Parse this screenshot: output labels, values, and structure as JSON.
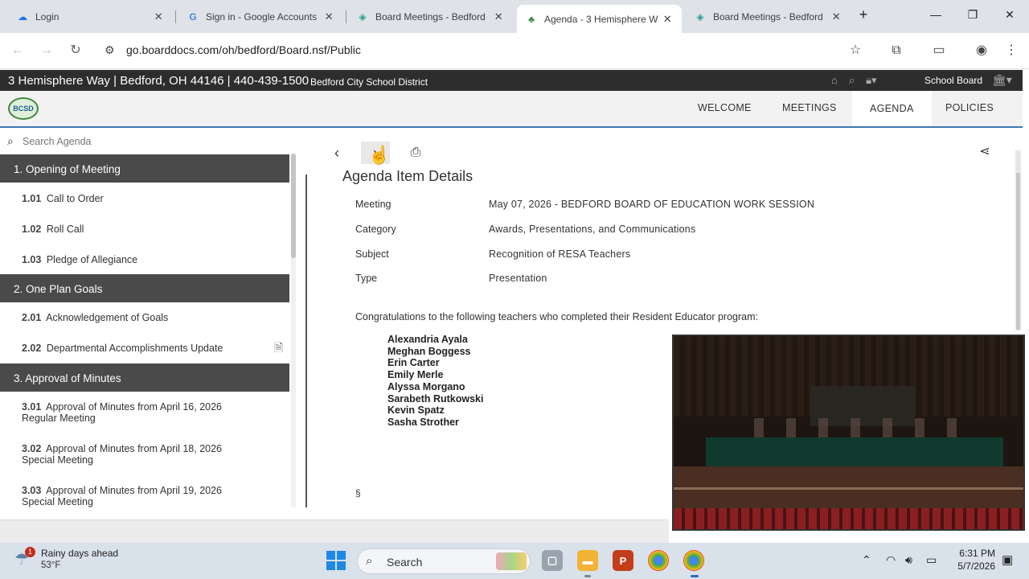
{
  "browser": {
    "tabs": [
      {
        "title": "Login",
        "favicon": "cloud-icon",
        "active": false
      },
      {
        "title": "Sign in - Google Accounts",
        "favicon": "google-icon",
        "active": false
      },
      {
        "title": "Board Meetings - Bedford",
        "favicon": "boarddocs-icon",
        "active": false
      },
      {
        "title": "Agenda - 3 Hemisphere W",
        "favicon": "tree-icon",
        "active": true
      },
      {
        "title": "Board Meetings - Bedford",
        "favicon": "boarddocs-icon",
        "active": false
      }
    ],
    "close_glyph": "✕",
    "new_tab_glyph": "+",
    "url": "go.boarddocs.com/oh/bedford/Board.nsf/Public"
  },
  "site": {
    "address": "3 Hemisphere Way | Bedford, OH 44146 | 440-439-1500",
    "district": "Bedford City School District",
    "board_label": "School Board",
    "logo_text": "BCSD",
    "nav": [
      "WELCOME",
      "MEETINGS",
      "AGENDA",
      "POLICIES"
    ],
    "active_nav": "AGENDA"
  },
  "sidebar": {
    "search_placeholder": "Search Agenda",
    "sections": [
      {
        "header": "1. Opening of Meeting",
        "items": [
          {
            "num": "1.01",
            "label": "Call to Order"
          },
          {
            "num": "1.02",
            "label": "Roll Call"
          },
          {
            "num": "1.03",
            "label": "Pledge of Allegiance"
          }
        ]
      },
      {
        "header": "2. One Plan Goals",
        "items": [
          {
            "num": "2.01",
            "label": "Acknowledgement of Goals"
          },
          {
            "num": "2.02",
            "label": "Departmental Accomplishments Update"
          }
        ]
      },
      {
        "header": "3. Approval of Minutes",
        "items": [
          {
            "num": "3.01",
            "label": "Approval of Minutes from April 16, 2026",
            "label2": "Regular Meeting"
          },
          {
            "num": "3.02",
            "label": "Approval of Minutes from April 18, 2026",
            "label2": "Special Meeting"
          },
          {
            "num": "3.03",
            "label": "Approval of Minutes from April 19, 2026",
            "label2": "Special Meeting"
          }
        ]
      }
    ]
  },
  "detail": {
    "title": "Agenda Item Details",
    "fields": [
      {
        "label": "Meeting",
        "value": "May 07, 2026 - BEDFORD BOARD OF EDUCATION WORK SESSION"
      },
      {
        "label": "Category",
        "value": "Awards, Presentations, and Communications"
      },
      {
        "label": "Subject",
        "value": "Recognition of RESA Teachers"
      },
      {
        "label": "Type",
        "value": "Presentation"
      }
    ],
    "intro": "Congratulations to the following teachers who completed their Resident Educator program:",
    "teachers": [
      "Alexandria Ayala",
      "Meghan Boggess",
      "Erin Carter",
      "Emily Merle",
      "Alyssa Morgano",
      "Sarabeth Rutkowski",
      "Kevin Spatz",
      "Sasha Strother"
    ],
    "section_mark": "§"
  },
  "taskbar": {
    "weather_text": "Rainy days ahead",
    "weather_temp": "53°F",
    "weather_badge": "1",
    "search_label": "Search",
    "time": "6:31 PM",
    "date": "5/7/2026"
  }
}
